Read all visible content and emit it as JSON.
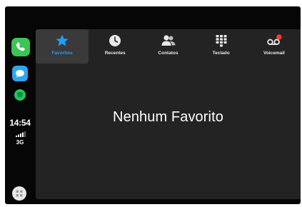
{
  "status": {
    "time": "14:54",
    "network": "3G"
  },
  "dock": {
    "apps": [
      "phone-icon",
      "messages-icon",
      "spotify-icon"
    ],
    "home_icon": "carplay-home-icon"
  },
  "tabs": [
    {
      "label": "Favoritos",
      "icon": "star-icon",
      "active": true
    },
    {
      "label": "Recentes",
      "icon": "clock-icon",
      "active": false
    },
    {
      "label": "Contatos",
      "icon": "contacts-icon",
      "active": false
    },
    {
      "label": "Teclado",
      "icon": "keypad-icon",
      "active": false
    },
    {
      "label": "Voicemail",
      "icon": "voicemail-icon",
      "active": false
    }
  ],
  "main": {
    "empty_message": "Nenhum Favorito"
  },
  "colors": {
    "accent": "#1aa0ff",
    "phone_green": "#3cc454",
    "badge_red": "#ff3b30",
    "panel_bg": "#232323",
    "active_tab_bg": "#3a3a3a"
  }
}
